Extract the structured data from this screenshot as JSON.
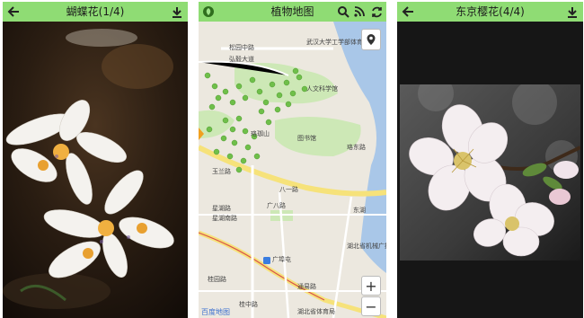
{
  "screens": [
    {
      "title": "蝴蝶花(1/4)"
    },
    {
      "title": "植物地图"
    },
    {
      "title": "东京樱花(4/4)"
    }
  ],
  "map": {
    "labels": [
      "松园中路",
      "武汉大学工学部体育馆",
      "弘毅大道",
      "人文科学馆",
      "樱园路",
      "珞东路",
      "玉兰路",
      "八一路",
      "星湖路",
      "星湖南路",
      "广八路",
      "湖北省机械广播局",
      "桂园路",
      "珞东路",
      "通易路",
      "广埠屯",
      "洪山大道",
      "湖北省体育局",
      "桂中路",
      "中路",
      "珞珈山",
      "图书馆",
      "东湖",
      "卓刀泉北路",
      "桂园路",
      "珞珈门",
      "桂园路"
    ],
    "zoom_in": "+",
    "zoom_out": "−",
    "watermark": "百度地图"
  },
  "colors": {
    "toolbar": "#8fdc74",
    "photo_bg": "#161616"
  }
}
